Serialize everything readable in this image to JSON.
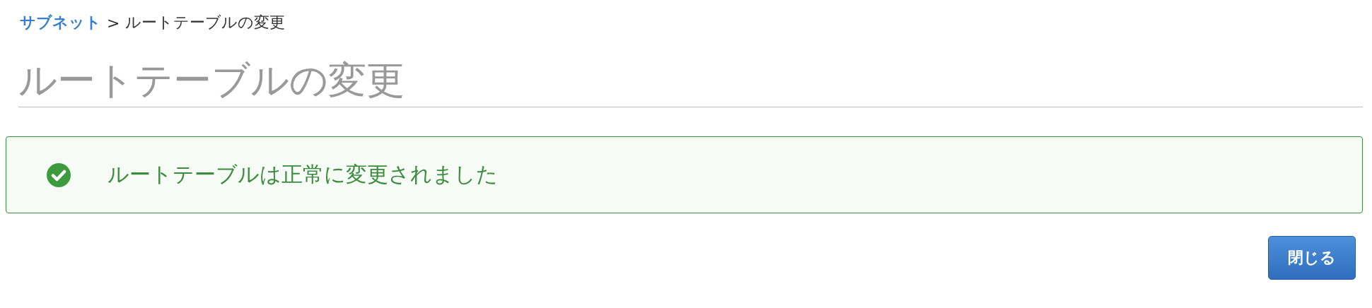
{
  "breadcrumb": {
    "separator": ">",
    "items": [
      {
        "label": "サブネット",
        "kind": "link"
      },
      {
        "label": "ルートテーブルの変更",
        "kind": "current"
      }
    ]
  },
  "title": "ルートテーブルの変更",
  "alert": {
    "kind": "success",
    "message": "ルートテーブルは正常に変更されました"
  },
  "buttons": [
    {
      "label": "閉じる",
      "kind": "primary"
    }
  ]
}
